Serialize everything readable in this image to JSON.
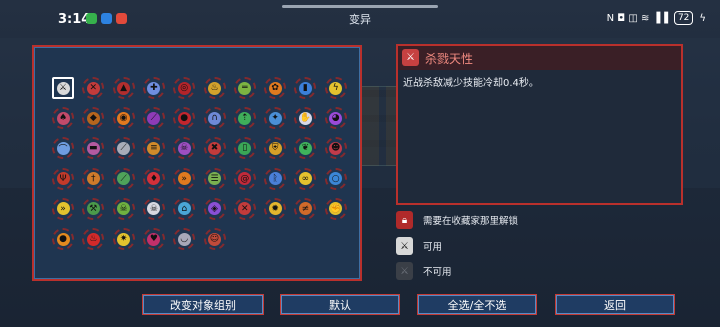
{
  "status_bar": {
    "time": "3:14",
    "battery": "72",
    "signal_text": "N ◘ ◫ ≋ ▐▐",
    "notification_colors": [
      "#36b14c",
      "#2d82e0",
      "#e24a3b"
    ]
  },
  "window": {
    "title": "变异"
  },
  "info": {
    "title": "杀戮天性",
    "description": "近战杀敌减少技能冷却0.4秒。"
  },
  "legend": [
    {
      "label": "需要在收藏家那里解锁",
      "icon": "lock-icon"
    },
    {
      "label": "可用",
      "icon": "available-icon"
    },
    {
      "label": "不可用",
      "icon": "unavailable-icon"
    }
  ],
  "buttons": {
    "change_group": "改变对象组别",
    "default": "默认",
    "select_all": "全选/全不选",
    "back": "返回"
  },
  "mutation_icons": [
    {
      "name": "killer-instinct-icon",
      "color": "#d9d9d9",
      "glyph": "⚔"
    },
    {
      "name": "crossbow-icon",
      "color": "#c23b3b",
      "glyph": "✕"
    },
    {
      "name": "red-spike-icon",
      "color": "#b22e2e",
      "glyph": "▲"
    },
    {
      "name": "tactics-icon",
      "color": "#6f8ee0",
      "glyph": "✚"
    },
    {
      "name": "blood-swirl-icon",
      "color": "#b3242a",
      "glyph": "◎"
    },
    {
      "name": "fire-potion-icon",
      "color": "#d3a22c",
      "glyph": "♨"
    },
    {
      "name": "gun-icon",
      "color": "#7cb342",
      "glyph": "═"
    },
    {
      "name": "orange-gear-icon",
      "color": "#e07a1f",
      "glyph": "✿"
    },
    {
      "name": "blue-vial-icon",
      "color": "#3b7fd8",
      "glyph": "▮"
    },
    {
      "name": "lightning-icon",
      "color": "#e3c22e",
      "glyph": "ϟ"
    },
    {
      "name": "mushroom-icon",
      "color": "#c24a6a",
      "glyph": "♠"
    },
    {
      "name": "shield-hammer-icon",
      "color": "#b5651d",
      "glyph": "◆"
    },
    {
      "name": "orange-eye-icon",
      "color": "#e37a1f",
      "glyph": "◉"
    },
    {
      "name": "purple-blade-icon",
      "color": "#8e3bb7",
      "glyph": "⟋"
    },
    {
      "name": "red-drop-icon",
      "color": "#c2262e",
      "glyph": "●"
    },
    {
      "name": "magnet-icon",
      "color": "#6e8ad8",
      "glyph": "∩"
    },
    {
      "name": "green-arrow-icon",
      "color": "#3fae5a",
      "glyph": "⇡"
    },
    {
      "name": "blue-shield-icon",
      "color": "#4a8fd6",
      "glyph": "✦"
    },
    {
      "name": "hand-icon",
      "color": "#d8d8e8",
      "glyph": "✋"
    },
    {
      "name": "purple-orb-icon",
      "color": "#9a4ad8",
      "glyph": "◕"
    },
    {
      "name": "bow-icon",
      "color": "#6f9ce0",
      "glyph": "⌒"
    },
    {
      "name": "turret-icon",
      "color": "#b35aa0",
      "glyph": "▬"
    },
    {
      "name": "spear-icon",
      "color": "#a8acb8",
      "glyph": "⟋"
    },
    {
      "name": "gold-stack-icon",
      "color": "#d08a2a",
      "glyph": "≡"
    },
    {
      "name": "purple-skull-icon",
      "color": "#9d4fc2",
      "glyph": "☠"
    },
    {
      "name": "red-x-icon",
      "color": "#c23b3b",
      "glyph": "✖"
    },
    {
      "name": "green-bottle-icon",
      "color": "#3aa556",
      "glyph": "▯"
    },
    {
      "name": "red-yellow-shield-icon",
      "color": "#d6a028",
      "glyph": "⛨"
    },
    {
      "name": "green-leaf-icon",
      "color": "#3fb35c",
      "glyph": "❦"
    },
    {
      "name": "red-mask-icon",
      "color": "#c23b4a",
      "glyph": "☻"
    },
    {
      "name": "goblet-icon",
      "color": "#c23a2a",
      "glyph": "Ψ"
    },
    {
      "name": "sword-icon",
      "color": "#d07a2a",
      "glyph": "†"
    },
    {
      "name": "green-blade-icon",
      "color": "#4fa35a",
      "glyph": "⟋"
    },
    {
      "name": "red-potion-icon",
      "color": "#d2303a",
      "glyph": "♦"
    },
    {
      "name": "chevron-right-icon",
      "color": "#e07a1f",
      "glyph": "»"
    },
    {
      "name": "grimoire-icon",
      "color": "#7ab050",
      "glyph": "☰"
    },
    {
      "name": "red-spiral-icon",
      "color": "#c22a3a",
      "glyph": "@"
    },
    {
      "name": "blue-rune-icon",
      "color": "#4a7fd8",
      "glyph": "ᚱ"
    },
    {
      "name": "yellow-coil-icon",
      "color": "#e3c22e",
      "glyph": "∞"
    },
    {
      "name": "blue-ring-icon",
      "color": "#3b86d6",
      "glyph": "○"
    },
    {
      "name": "fast-forward-icon",
      "color": "#e3c22e",
      "glyph": "»"
    },
    {
      "name": "green-axe-icon",
      "color": "#4b9a4a",
      "glyph": "⚒"
    },
    {
      "name": "green-skull-icon",
      "color": "#6fb040",
      "glyph": "☠"
    },
    {
      "name": "white-skull-icon",
      "color": "#d8d8e0",
      "glyph": "☠"
    },
    {
      "name": "blue-hat-icon",
      "color": "#4aa6d6",
      "glyph": "⌂"
    },
    {
      "name": "purple-cloak-icon",
      "color": "#8a4fd6",
      "glyph": "◈"
    },
    {
      "name": "crossed-axes-icon",
      "color": "#c23b3b",
      "glyph": "✕"
    },
    {
      "name": "yellow-star-icon",
      "color": "#e3b52e",
      "glyph": "✹"
    },
    {
      "name": "flame-blade-icon",
      "color": "#d06a2a",
      "glyph": "≠"
    },
    {
      "name": "yellow-fist-icon",
      "color": "#e3c22e",
      "glyph": "✊"
    },
    {
      "name": "orange-gauntlet-icon",
      "color": "#e38a1f",
      "glyph": "●"
    },
    {
      "name": "fire-drop-icon",
      "color": "#d22a2a",
      "glyph": "♨"
    },
    {
      "name": "yellow-spark-icon",
      "color": "#e3c22e",
      "glyph": "✷"
    },
    {
      "name": "magenta-heart-icon",
      "color": "#c2306a",
      "glyph": "♥"
    },
    {
      "name": "cauldron-icon",
      "color": "#a8a8b8",
      "glyph": "◡"
    },
    {
      "name": "red-face-icon",
      "color": "#c24a3a",
      "glyph": "☺"
    }
  ]
}
